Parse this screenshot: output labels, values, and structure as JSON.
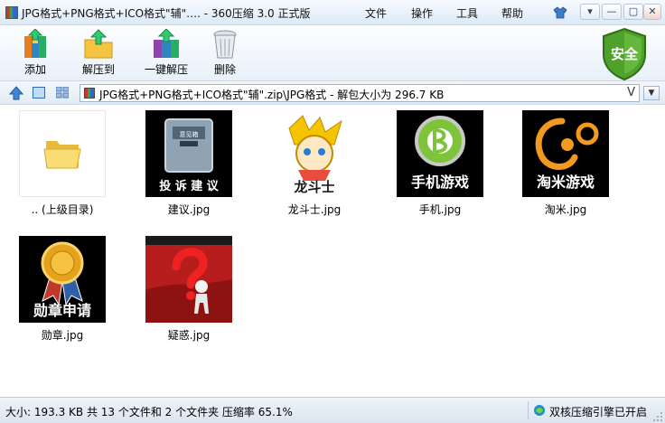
{
  "window": {
    "title": "JPG格式+PNG格式+ICO格式\"辅\"…. - 360压缩 3.0 正式版",
    "menu": [
      "文件",
      "操作",
      "工具",
      "帮助"
    ],
    "controls": {
      "minimize": "—",
      "restore": "▢",
      "close": "✕"
    }
  },
  "toolbar": {
    "add_label": "添加",
    "extract_to_label": "解压到",
    "one_click_extract_label": "一键解压",
    "delete_label": "删除",
    "security_label": "安全"
  },
  "address": {
    "path": "JPG格式+PNG格式+ICO格式\"辅\".zip\\JPG格式 - 解包大小为 296.7 KB",
    "dropdown": "V"
  },
  "files": [
    {
      "name": ".. (上级目录)",
      "type": "parent-folder"
    },
    {
      "name": "建议.jpg",
      "type": "image",
      "thumb_text": "投 诉 建 议",
      "thumb_sub": "意见箱"
    },
    {
      "name": "龙斗士.jpg",
      "type": "image",
      "thumb_text": "龙斗士"
    },
    {
      "name": "手机.jpg",
      "type": "image",
      "thumb_text": "手机游戏"
    },
    {
      "name": "淘米.jpg",
      "type": "image",
      "thumb_text": "淘米游戏"
    },
    {
      "name": "勋章.jpg",
      "type": "image",
      "thumb_text": "勋章申请"
    },
    {
      "name": "疑惑.jpg",
      "type": "image"
    }
  ],
  "status": {
    "summary": "大小: 193.3 KB 共 13 个文件和 2 个文件夹 压缩率 65.1%",
    "engine": "双核压缩引擎已开启"
  },
  "colors": {
    "accent": "#2d6bb5",
    "shield": "#4ea12a",
    "title_bg": "#dde9f6"
  }
}
